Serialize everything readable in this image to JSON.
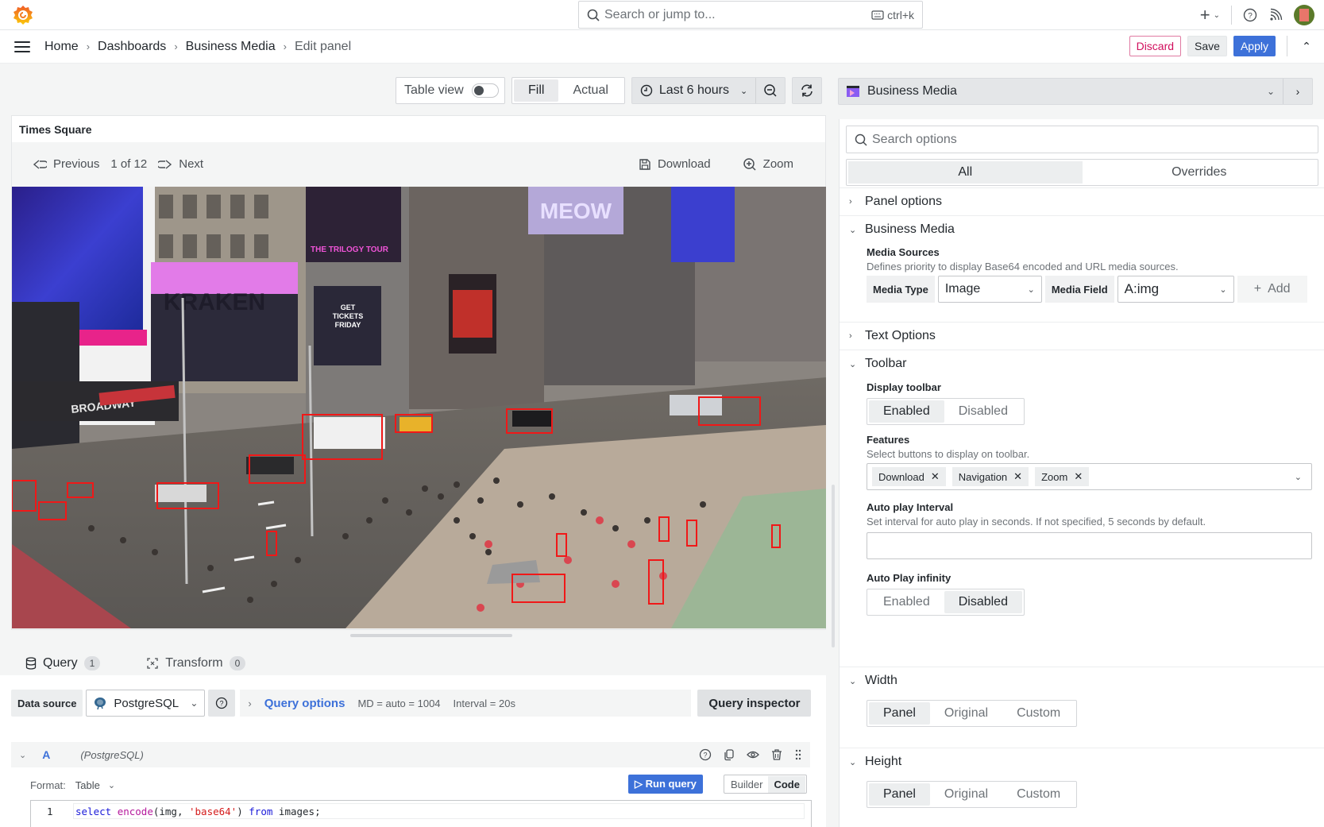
{
  "topbar": {
    "search_placeholder": "Search or jump to...",
    "shortcut": "ctrl+k"
  },
  "breadcrumb": [
    "Home",
    "Dashboards",
    "Business Media",
    "Edit panel"
  ],
  "actions": {
    "discard": "Discard",
    "save": "Save",
    "apply": "Apply"
  },
  "panel_toolbar": {
    "table_view_label": "Table view",
    "table_view_on": false,
    "fit_options": [
      "Fill",
      "Actual"
    ],
    "fit_selected": "Fill",
    "time_range": "Last 6 hours"
  },
  "panel": {
    "title": "Times Square",
    "nav": {
      "previous": "Previous",
      "counter": "1 of 12",
      "next": "Next"
    },
    "download": "Download",
    "zoom": "Zoom",
    "image_description": "Times Square street scene with object-detection bounding boxes"
  },
  "query_tabs": [
    {
      "label": "Query",
      "count": "1",
      "active": true
    },
    {
      "label": "Transform",
      "count": "0",
      "active": false
    }
  ],
  "datasource": {
    "label": "Data source",
    "value": "PostgreSQL",
    "query_options_label": "Query options",
    "md": "MD = auto = 1004",
    "interval": "Interval = 20s",
    "inspector": "Query inspector"
  },
  "query": {
    "ref": "A",
    "ds": "(PostgreSQL)",
    "format_label": "Format:",
    "format_value": "Table",
    "run": "Run query",
    "modes": [
      "Builder",
      "Code"
    ],
    "mode_selected": "Code",
    "line_number": "1",
    "sql_tokens": [
      {
        "t": "select",
        "c": "kw"
      },
      {
        "t": " ",
        "c": ""
      },
      {
        "t": "encode",
        "c": "fn"
      },
      {
        "t": "(img, ",
        "c": ""
      },
      {
        "t": "'base64'",
        "c": "str"
      },
      {
        "t": ") ",
        "c": ""
      },
      {
        "t": "from",
        "c": "kw"
      },
      {
        "t": " images;",
        "c": ""
      }
    ]
  },
  "options": {
    "visualization": "Business Media",
    "search_placeholder": "Search options",
    "tabs": [
      "All",
      "Overrides"
    ],
    "tab_selected": "All",
    "sections": {
      "panel_options": "Panel options",
      "business_media": "Business Media",
      "text_options": "Text Options",
      "toolbar": "Toolbar",
      "width": "Width",
      "height": "Height"
    },
    "media_sources": {
      "label": "Media Sources",
      "desc": "Defines priority to display Base64 encoded and URL media sources.",
      "type_label": "Media Type",
      "type_value": "Image",
      "field_label": "Media Field",
      "field_value": "A:img",
      "add": "Add"
    },
    "display_toolbar": {
      "label": "Display toolbar",
      "options": [
        "Enabled",
        "Disabled"
      ],
      "selected": "Enabled"
    },
    "features": {
      "label": "Features",
      "desc": "Select buttons to display on toolbar.",
      "tags": [
        "Download",
        "Navigation",
        "Zoom"
      ]
    },
    "auto_play_interval": {
      "label": "Auto play Interval",
      "desc": "Set interval for auto play in seconds. If not specified, 5 seconds by default.",
      "value": ""
    },
    "auto_play_infinity": {
      "label": "Auto Play infinity",
      "options": [
        "Enabled",
        "Disabled"
      ],
      "selected": "Disabled"
    },
    "width_mode": {
      "options": [
        "Panel",
        "Original",
        "Custom"
      ],
      "selected": "Panel"
    },
    "height_mode": {
      "options": [
        "Panel",
        "Original",
        "Custom"
      ],
      "selected": "Panel"
    }
  }
}
